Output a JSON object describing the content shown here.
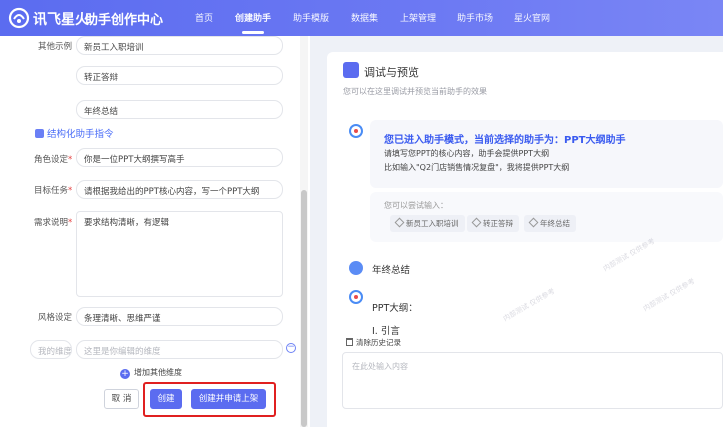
{
  "header": {
    "brand": "讯飞星火",
    "app_title": "助手创作中心",
    "nav": [
      "首页",
      "创建助手",
      "助手模版",
      "数据集",
      "上架管理",
      "助手市场",
      "星火官网"
    ],
    "active_nav": "创建助手"
  },
  "form": {
    "examples_label": "其他示例",
    "examples": [
      "新员工入职培训",
      "转正答辩",
      "年终总结"
    ],
    "section_title": "结构化助手指令",
    "role_label": "角色设定",
    "role_value": "你是一位PPT大纲撰写高手",
    "goal_label": "目标任务",
    "goal_value": "请根据我给出的PPT核心内容，写一个PPT大纲",
    "req_label": "需求说明",
    "req_value": "要求结构清晰，有逻辑",
    "style_label": "风格设定",
    "style_value": "条理清晰、思维严谨",
    "custom_label_placeholder": "我的维度",
    "custom_value_placeholder": "这里是你编辑的维度",
    "add_dimension": "增加其他维度",
    "required_mark": "*"
  },
  "buttons": {
    "cancel": "取 消",
    "create": "创建",
    "create_and_apply": "创建并申请上架"
  },
  "preview": {
    "title": "调试与预览",
    "subtitle": "您可以在这里调试并预览当前助手的效果",
    "welcome_title": "您已进入助手模式，当前选择的助手为：PPT大纲助手",
    "welcome_line1": "请填写您PPT的核心内容，助手会提供PPT大纲",
    "welcome_line2": "比如输入\"Q2门店销售情况复盘\"，我将提供PPT大纲",
    "try_label": "您可以尝试输入：",
    "try_chips": [
      "新员工入职培训",
      "转正答辩",
      "年终总结"
    ],
    "user_message": "年终总结",
    "bot_reply_1": "PPT大纲：",
    "bot_reply_2": "I. 引言",
    "clear_history": "清除历史记录",
    "input_placeholder": "在此处输入内容"
  },
  "colors": {
    "accent": "#5b6cf0",
    "highlight_border": "#e02020"
  }
}
